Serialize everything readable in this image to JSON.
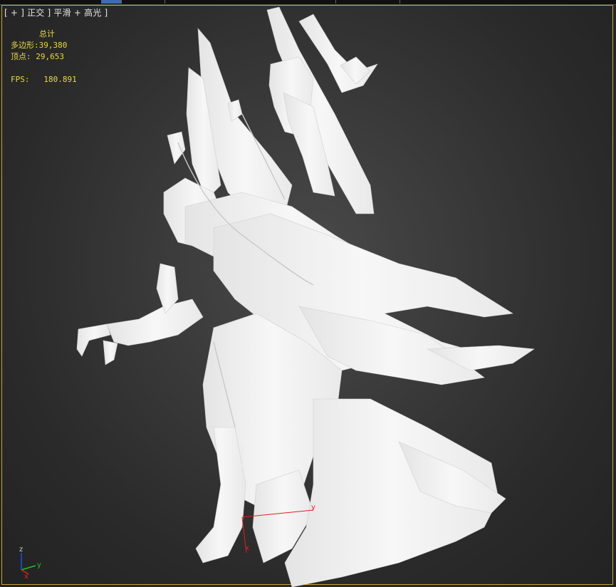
{
  "viewport": {
    "label_parts": [
      "[",
      "+",
      "]",
      "正交",
      "]",
      "平滑",
      "+",
      "高光",
      "]"
    ],
    "label_text": "[ + ] 正交 ] 平滑 + 高光 ]",
    "bracket_open": "[",
    "plus_menu": "+",
    "view_menu": "正交",
    "shading_menu": "平滑",
    "plus_highlight": "+",
    "highlight_menu": "高光",
    "bracket_close": "]"
  },
  "stats": {
    "total_label": "总计",
    "polygons_label": "多边形:",
    "polygons_value": "39,380",
    "vertices_label": "顶点:",
    "vertices_value": "29,653",
    "fps_label": "FPS:",
    "fps_value": "180.891"
  },
  "gizmo": {
    "z": "z",
    "y": "y",
    "x": "x"
  },
  "world_axis": {
    "z": "z",
    "y": "y",
    "x": "x"
  },
  "colors": {
    "frame": "#c9a227",
    "stats_text": "#e8d84a",
    "model": "#f2f2f2",
    "x_axis": "#e02020",
    "y_axis": "#20c020",
    "z_axis": "#2050e0"
  }
}
